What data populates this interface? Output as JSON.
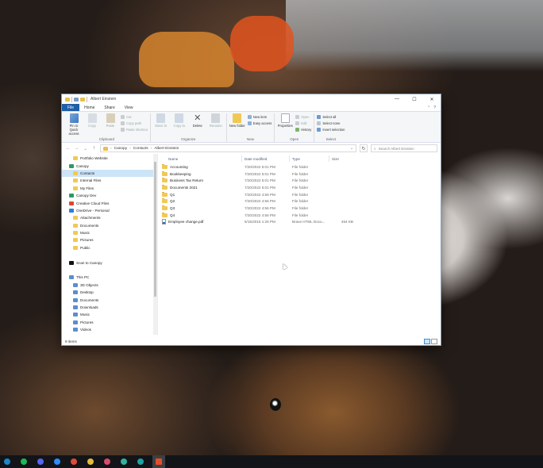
{
  "window": {
    "title": "Albert Einstein",
    "controls": [
      "—",
      "☐",
      "✕"
    ]
  },
  "ribbon_tabs": [
    "File",
    "Home",
    "Share",
    "View"
  ],
  "ribbon": {
    "clipboard": {
      "label": "Clipboard",
      "pin": "Pin to Quick access",
      "copy": "Copy",
      "paste": "Paste",
      "cut": "Cut",
      "copy_path": "Copy path",
      "paste_shortcut": "Paste shortcut"
    },
    "organize": {
      "label": "Organize",
      "move_to": "Move to",
      "copy_to": "Copy to",
      "delete": "Delete",
      "rename": "Rename"
    },
    "new": {
      "label": "New",
      "new_folder": "New folder",
      "new_item": "New item",
      "easy_access": "Easy access"
    },
    "open": {
      "label": "Open",
      "properties": "Properties",
      "open": "Open",
      "edit": "Edit",
      "history": "History"
    },
    "select": {
      "label": "Select",
      "select_all": "Select all",
      "select_none": "Select none",
      "invert_selection": "Invert selection"
    }
  },
  "address": {
    "crumbs": [
      "Canopy",
      "Contacts",
      "Albert Einstein"
    ],
    "search_placeholder": "Search Albert Einstein"
  },
  "nav": [
    {
      "label": "Portfolio Website",
      "indent": 1,
      "icon": "folder"
    },
    {
      "label": "Canopy",
      "indent": 0,
      "icon": "canopy"
    },
    {
      "label": "Contacts",
      "indent": 1,
      "icon": "folder",
      "selected": true
    },
    {
      "label": "Internal Files",
      "indent": 1,
      "icon": "folder"
    },
    {
      "label": "My Files",
      "indent": 1,
      "icon": "folder"
    },
    {
      "label": "Canopy Dev",
      "indent": 0,
      "icon": "canopy"
    },
    {
      "label": "Creative Cloud Files",
      "indent": 0,
      "icon": "cc"
    },
    {
      "label": "OneDrive - Personal",
      "indent": 0,
      "icon": "onedrive"
    },
    {
      "label": "Attachments",
      "indent": 1,
      "icon": "folder"
    },
    {
      "label": "Documents",
      "indent": 1,
      "icon": "folder"
    },
    {
      "label": "Music",
      "indent": 1,
      "icon": "folder"
    },
    {
      "label": "Pictures",
      "indent": 1,
      "icon": "folder"
    },
    {
      "label": "Public",
      "indent": 1,
      "icon": "folder"
    },
    {
      "label": "",
      "indent": 0,
      "icon": "none"
    },
    {
      "label": "Scan to Canopy",
      "indent": 0,
      "icon": "scan"
    },
    {
      "label": "",
      "indent": 0,
      "icon": "none"
    },
    {
      "label": "This PC",
      "indent": 0,
      "icon": "pc"
    },
    {
      "label": "3D Objects",
      "indent": 1,
      "icon": "blue"
    },
    {
      "label": "Desktop",
      "indent": 1,
      "icon": "blue"
    },
    {
      "label": "Documents",
      "indent": 1,
      "icon": "blue"
    },
    {
      "label": "Downloads",
      "indent": 1,
      "icon": "blue"
    },
    {
      "label": "Music",
      "indent": 1,
      "icon": "blue"
    },
    {
      "label": "Pictures",
      "indent": 1,
      "icon": "blue"
    },
    {
      "label": "Videos",
      "indent": 1,
      "icon": "blue"
    }
  ],
  "columns": {
    "name": "Name",
    "date": "Date modified",
    "type": "Type",
    "size": "Size"
  },
  "files": [
    {
      "name": "Accounting",
      "date": "7/20/2022 5:01 PM",
      "type": "File folder",
      "size": "",
      "kind": "folder"
    },
    {
      "name": "Bookkeeping",
      "date": "7/20/2022 5:01 PM",
      "type": "File folder",
      "size": "",
      "kind": "folder"
    },
    {
      "name": "Business Tax Return",
      "date": "7/20/2022 5:01 PM",
      "type": "File folder",
      "size": "",
      "kind": "folder"
    },
    {
      "name": "Documents 2021",
      "date": "7/20/2022 5:01 PM",
      "type": "File folder",
      "size": "",
      "kind": "folder"
    },
    {
      "name": "Q1",
      "date": "7/20/2022 4:56 PM",
      "type": "File folder",
      "size": "",
      "kind": "folder"
    },
    {
      "name": "Q2",
      "date": "7/20/2022 4:56 PM",
      "type": "File folder",
      "size": "",
      "kind": "folder"
    },
    {
      "name": "Q3",
      "date": "7/20/2022 4:56 PM",
      "type": "File folder",
      "size": "",
      "kind": "folder"
    },
    {
      "name": "Q4",
      "date": "7/20/2022 4:56 PM",
      "type": "File folder",
      "size": "",
      "kind": "folder"
    },
    {
      "name": "Employee change.pdf",
      "date": "6/15/2015 1:26 PM",
      "type": "Brave HTML Docu...",
      "size": "454 KB",
      "kind": "pdf"
    }
  ],
  "status": {
    "items": "9 items"
  },
  "colors": {
    "file_tab": "#1f5fa8",
    "selection": "#cce4f7",
    "folder": "#f0c955",
    "taskbar": "#121418"
  },
  "taskbar": [
    {
      "name": "steam-icon",
      "color": "#1b86c9"
    },
    {
      "name": "spotify-icon",
      "color": "#1db954"
    },
    {
      "name": "discord-icon",
      "color": "#5865f2"
    },
    {
      "name": "zoom-icon",
      "color": "#2d8cff"
    },
    {
      "name": "app-red-icon",
      "color": "#e04a3a"
    },
    {
      "name": "chrome-icon",
      "color": "#e9b93a"
    },
    {
      "name": "slack-icon",
      "color": "#d94a6a"
    },
    {
      "name": "app-teal-icon",
      "color": "#2fb3a0"
    },
    {
      "name": "webstorm-icon",
      "color": "#1aa3a3"
    },
    {
      "name": "html5-icon",
      "color": "#e34f26"
    }
  ]
}
